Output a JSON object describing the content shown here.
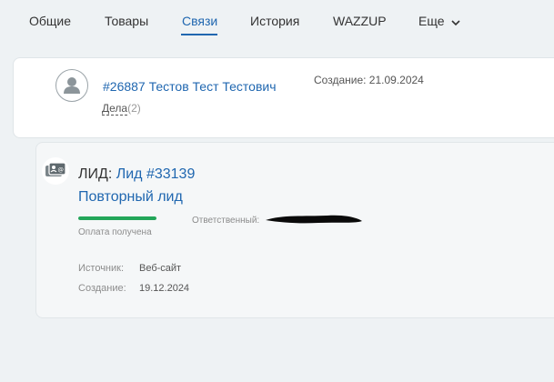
{
  "tabs": [
    {
      "label": "Общие"
    },
    {
      "label": "Товары"
    },
    {
      "label": "Связи"
    },
    {
      "label": "История"
    },
    {
      "label": "WAZZUP"
    },
    {
      "label": "Еще"
    }
  ],
  "active_tab": "Связи",
  "contact": {
    "link": "#26887 Тестов Тест Тестович",
    "deals_label": "Дела",
    "deals_count": "(2)",
    "created": "Создание: 21.09.2024"
  },
  "lead": {
    "prefix": "ЛИД:",
    "link": "Лид #33139",
    "repeat": "Повторный лид",
    "progress": 1.0,
    "progress_color": "#22a659",
    "stage": "Оплата получена",
    "responsible_label": "Ответственный:",
    "source_label": "Источник:",
    "source_value": "Веб-сайт",
    "created_label": "Создание:",
    "created_value": "19.12.2024"
  },
  "colors": {
    "accent": "#2067b0",
    "background": "#eef2f4"
  },
  "icons": {
    "user": "user-avatar-icon",
    "lead": "lead-card-icon",
    "more": "chevron-down-icon"
  }
}
